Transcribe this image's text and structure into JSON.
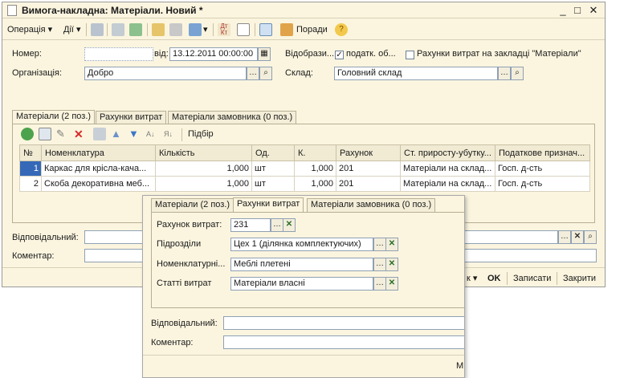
{
  "window": {
    "title": "Вимога-накладна: Матеріали. Новий *",
    "controls": {
      "minimize": "_",
      "maximize": "□",
      "close": "✕"
    }
  },
  "toolbar": {
    "operation": "Операція",
    "actions": "Дії",
    "hints": "Поради",
    "help": "?"
  },
  "header": {
    "number_label": "Номер:",
    "number_value": "",
    "date_label": "від:",
    "date_value": "13.12.2011 00:00:00",
    "reflect_label": "Відобрази...",
    "tax_label": "податк. об...",
    "tax_checked": true,
    "accounts_label": "Рахунки витрат на закладці \"Матеріали\"",
    "accounts_checked": false,
    "org_label": "Організація:",
    "org_value": "Добро",
    "warehouse_label": "Склад:",
    "warehouse_value": "Головний склад"
  },
  "tabs": [
    {
      "label": "Матеріали (2 поз.)",
      "active": true
    },
    {
      "label": "Рахунки витрат",
      "active": false
    },
    {
      "label": "Матеріали замовника (0 поз.)",
      "active": false
    }
  ],
  "table_toolbar": {
    "selection": "Підбір"
  },
  "table": {
    "columns": [
      "№",
      "Номенклатура",
      "Кількість",
      "Од.",
      "К.",
      "Рахунок",
      "Ст. приросту-убутку...",
      "Податкове признач..."
    ],
    "rows": [
      [
        "1",
        "Каркас для крісла-кача...",
        "1,000",
        "шт",
        "1,000",
        "201",
        "Матеріали на склад...",
        "Госп. д-сть"
      ],
      [
        "2",
        "Скоба декоративна меб...",
        "1,000",
        "шт",
        "1,000",
        "201",
        "Матеріали на склад...",
        "Госп. д-сть"
      ]
    ]
  },
  "footer": {
    "responsible_label": "Відповідальний:",
    "comment_label": "Коментар:",
    "print_partial": "к",
    "ok": "OK",
    "save": "Записати",
    "close": "Закрити"
  },
  "popup": {
    "tabs": [
      {
        "label": "Матеріали (2 поз.)",
        "active": false
      },
      {
        "label": "Рахунки витрат",
        "active": true
      },
      {
        "label": "Матеріали замовника (0 поз.)",
        "active": false
      }
    ],
    "fields": [
      {
        "label": "Рахунок витрат:",
        "value": "231"
      },
      {
        "label": "Підрозділи",
        "value": "Цех 1 (ділянка комплектуючих)"
      },
      {
        "label": "Номенклатурні...",
        "value": "Меблі плетені"
      },
      {
        "label": "Статті витрат",
        "value": "Матеріали власні"
      }
    ],
    "responsible_label": "Відповідальний:",
    "comment_label": "Коментар:",
    "bottom_partial": "М"
  }
}
